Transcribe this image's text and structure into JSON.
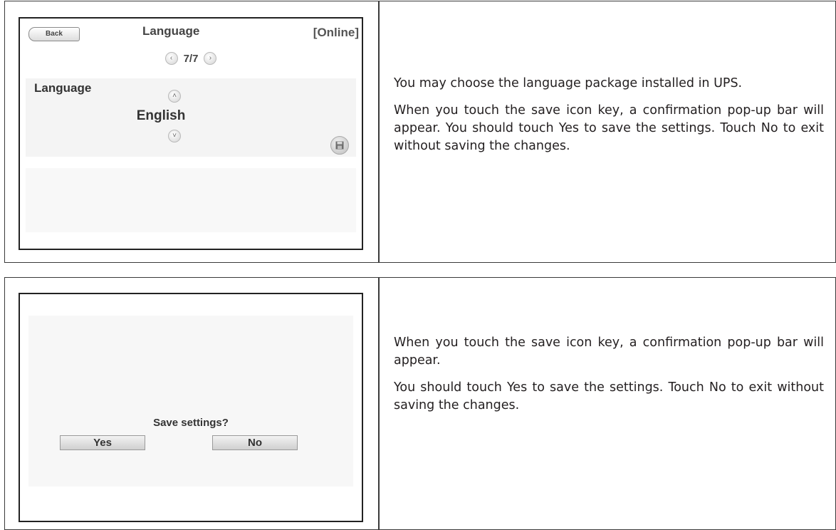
{
  "language_screen": {
    "back_label": "Back",
    "title": "Language",
    "status": "[Online]",
    "page_indicator": "7/7",
    "field_label": "Language",
    "value": "English"
  },
  "language_description": {
    "p1": "You may choose the language package installed in UPS.",
    "p2": "When you touch the save icon key, a confirmation pop-up bar will appear. You should touch Yes to save the settings. Touch No to exit without saving the changes."
  },
  "confirm_screen": {
    "prompt": "Save settings?",
    "yes_label": "Yes",
    "no_label": "No"
  },
  "confirm_description": {
    "p1": "When you touch the save icon key, a confirmation pop-up bar will appear.",
    "p2": " You should touch Yes to save the settings. Touch No to exit without saving the changes."
  },
  "icons": {
    "prev": "chevron-left-icon",
    "next": "chevron-right-icon",
    "up": "chevron-up-icon",
    "down": "chevron-down-icon",
    "save": "floppy-disk-icon"
  }
}
